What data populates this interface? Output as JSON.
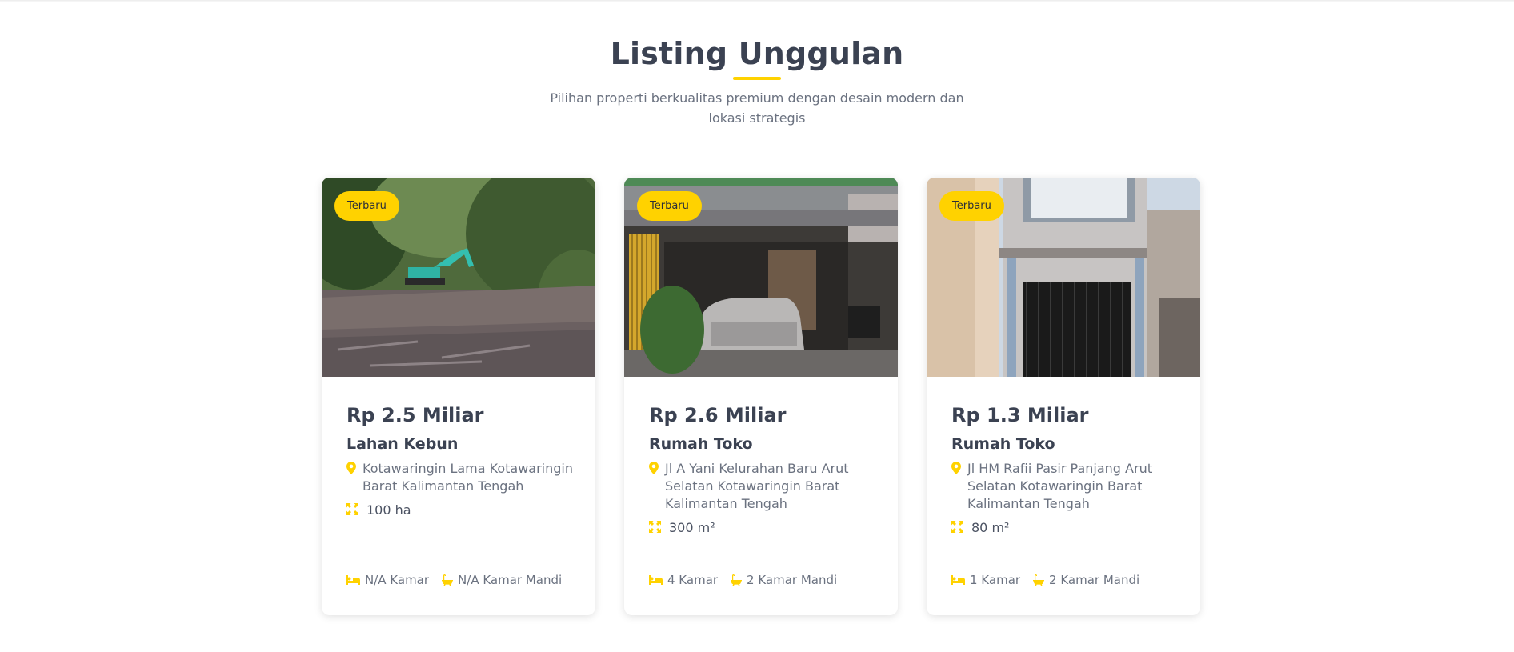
{
  "section": {
    "title": "Listing Unggulan",
    "subtitle": "Pilihan properti berkualitas premium dengan desain modern dan lokasi strategis"
  },
  "colors": {
    "accent": "#ffd200",
    "text_dark": "#3b4252",
    "text_muted": "#6b7280"
  },
  "listings": [
    {
      "badge": "Terbaru",
      "image": "excavator-clearing-land-photo",
      "price": "Rp 2.5 Miliar",
      "type": "Lahan Kebun",
      "location": "Kotawaringin Lama Kotawaringin Barat Kalimantan Tengah",
      "area": "100 ha",
      "bedrooms": "N/A Kamar",
      "bathrooms": "N/A Kamar Mandi"
    },
    {
      "badge": "Terbaru",
      "image": "shophouse-with-silver-car-photo",
      "price": "Rp 2.6 Miliar",
      "type": "Rumah Toko",
      "location": "Jl A Yani Kelurahan Baru Arut Selatan Kotawaringin Barat Kalimantan Tengah",
      "area": "300 m²",
      "bedrooms": "4 Kamar",
      "bathrooms": "2 Kamar Mandi"
    },
    {
      "badge": "Terbaru",
      "image": "two-storey-shophouse-facade-photo",
      "price": "Rp 1.3 Miliar",
      "type": "Rumah Toko",
      "location": "Jl HM Rafii Pasir Panjang Arut Selatan Kotawaringin Barat Kalimantan Tengah",
      "area": "80 m²",
      "bedrooms": "1 Kamar",
      "bathrooms": "2 Kamar Mandi"
    }
  ]
}
